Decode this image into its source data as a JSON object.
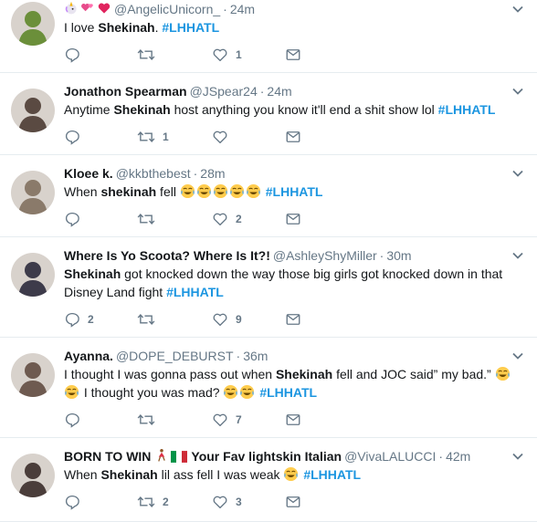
{
  "tweets": [
    {
      "name": "",
      "handle": "@AngelicUnicorn_",
      "dot": "·",
      "time": "24m",
      "segments": [
        {
          "t": "I love "
        },
        {
          "t": "Shekinah",
          "s": "b"
        },
        {
          "t": ". "
        },
        {
          "t": "#LHHATL",
          "s": "tag"
        }
      ],
      "replies": "",
      "retweets": "",
      "likes": "1",
      "badges": [
        "unicorn-emoji",
        "hearts-emoji",
        "heart-emoji"
      ],
      "avatar_color": "#6b8f3a"
    },
    {
      "name": "Jonathon Spearman",
      "handle": "@JSpear24",
      "dot": "·",
      "time": "24m",
      "segments": [
        {
          "t": "Anytime "
        },
        {
          "t": "Shekinah",
          "s": "b"
        },
        {
          "t": " host anything you know it'll end a shit show lol "
        },
        {
          "t": "#LHHATL",
          "s": "tag"
        }
      ],
      "replies": "",
      "retweets": "1",
      "likes": "",
      "badges": [],
      "avatar_color": "#5a4a42"
    },
    {
      "name": "Kloee k.",
      "handle": "@kkbthebest",
      "dot": "·",
      "time": "28m",
      "segments": [
        {
          "t": "When "
        },
        {
          "t": "shekinah",
          "s": "b"
        },
        {
          "t": " fell "
        },
        {
          "e": "joy"
        },
        {
          "e": "joy"
        },
        {
          "e": "joy"
        },
        {
          "e": "joy"
        },
        {
          "e": "joy"
        },
        {
          "t": " "
        },
        {
          "t": "#LHHATL",
          "s": "tag"
        }
      ],
      "replies": "",
      "retweets": "",
      "likes": "2",
      "badges": [],
      "avatar_color": "#8a7a6a"
    },
    {
      "name": "Where Is Yo Scoota? Where Is It?!",
      "handle": "@AshleyShyMiller",
      "dot": "·",
      "time": "30m",
      "segments": [
        {
          "t": "Shekinah",
          "s": "b"
        },
        {
          "t": " got knocked down the way those big girls got knocked down in that Disney Land fight "
        },
        {
          "t": "#LHHATL",
          "s": "tag"
        }
      ],
      "replies": "2",
      "retweets": "",
      "likes": "9",
      "badges": [],
      "avatar_color": "#3d3b4a"
    },
    {
      "name": "Ayanna.",
      "handle": "@DOPE_DEBURST",
      "dot": "·",
      "time": "36m",
      "segments": [
        {
          "t": "I thought I was gonna pass out when "
        },
        {
          "t": "Shekinah",
          "s": "b"
        },
        {
          "t": " fell and JOC said” my bad.” "
        },
        {
          "e": "joy"
        },
        {
          "e": "joy"
        },
        {
          "t": " I thought you was mad? "
        },
        {
          "e": "joy"
        },
        {
          "e": "joy"
        },
        {
          "t": " "
        },
        {
          "t": "#LHHATL",
          "s": "tag"
        }
      ],
      "replies": "",
      "retweets": "",
      "likes": "7",
      "badges": [],
      "avatar_color": "#6e5a50"
    },
    {
      "name": "BORN TO WIN",
      "name2": "Your Fav lightskin Italian",
      "handle": "@VivaLALUCCI",
      "dot": "·",
      "time": "42m",
      "segments": [
        {
          "t": "When "
        },
        {
          "t": "Shekinah",
          "s": "b"
        },
        {
          "t": " lil ass fell I was weak "
        },
        {
          "e": "joy"
        },
        {
          "t": " "
        },
        {
          "t": "#LHHATL",
          "s": "tag"
        }
      ],
      "replies": "",
      "retweets": "2",
      "likes": "3",
      "badges": [
        "dancer-emoji",
        "italy-flag"
      ],
      "avatar_color": "#4a3d3a"
    }
  ],
  "icons": {
    "reply": "reply-icon",
    "retweet": "retweet-icon",
    "like": "heart-outline-icon",
    "dm": "envelope-icon",
    "caret": "chevron-down-icon"
  },
  "colors": {
    "hashtag": "#1b95e0",
    "secondary": "#657786",
    "divider": "#e6ecf0"
  }
}
